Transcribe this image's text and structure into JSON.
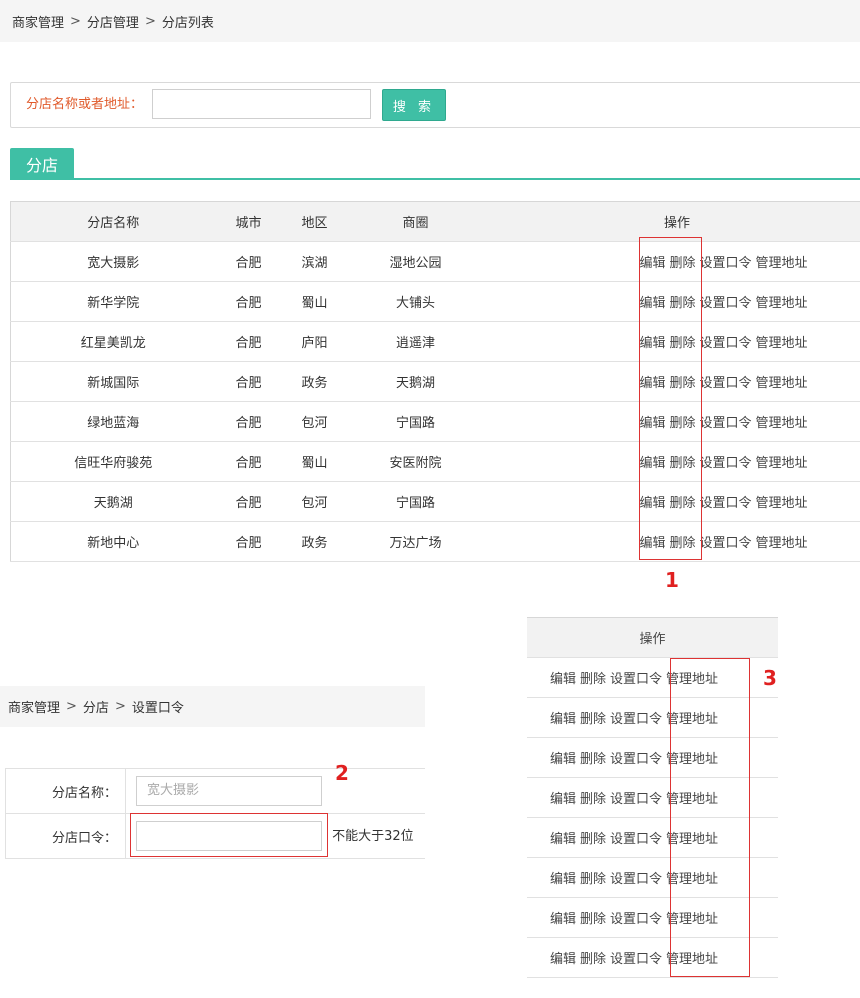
{
  "breadcrumb": {
    "items": [
      "商家管理",
      "分店管理",
      "分店列表"
    ],
    "sep": ">"
  },
  "search": {
    "label": "分店名称或者地址：",
    "input_value": "",
    "button_label": "搜 索"
  },
  "tab": {
    "label": "分店"
  },
  "table": {
    "headers": [
      "分店名称",
      "城市",
      "地区",
      "商圈",
      "操作"
    ],
    "rows": [
      [
        "宽大摄影",
        "合肥",
        "滨湖",
        "湿地公园"
      ],
      [
        "新华学院",
        "合肥",
        "蜀山",
        "大铺头"
      ],
      [
        "红星美凯龙",
        "合肥",
        "庐阳",
        "逍遥津"
      ],
      [
        "新城国际",
        "合肥",
        "政务",
        "天鹅湖"
      ],
      [
        "绿地蓝海",
        "合肥",
        "包河",
        "宁国路"
      ],
      [
        "信旺华府骏苑",
        "合肥",
        "蜀山",
        "安医附院"
      ],
      [
        "天鹅湖",
        "合肥",
        "包河",
        "宁国路"
      ],
      [
        "新地中心",
        "合肥",
        "政务",
        "万达广场"
      ]
    ],
    "actions": [
      "编辑",
      "删除",
      "设置口令",
      "管理地址"
    ]
  },
  "annotations": [
    "1",
    "2",
    "3"
  ],
  "breadcrumb2": {
    "items": [
      "商家管理",
      "分店",
      "设置口令"
    ],
    "sep": ">"
  },
  "form": {
    "name_label": "分店名称：",
    "name_placeholder": "宽大摄影",
    "password_label": "分店口令：",
    "password_value": "",
    "password_hint": "不能大于32位"
  },
  "ops_panel": {
    "header": "操作",
    "row_count": 8
  },
  "colors": {
    "accent": "#3fbfa5",
    "label_orange": "#e05a2b",
    "highlight_red": "#dd3333"
  }
}
